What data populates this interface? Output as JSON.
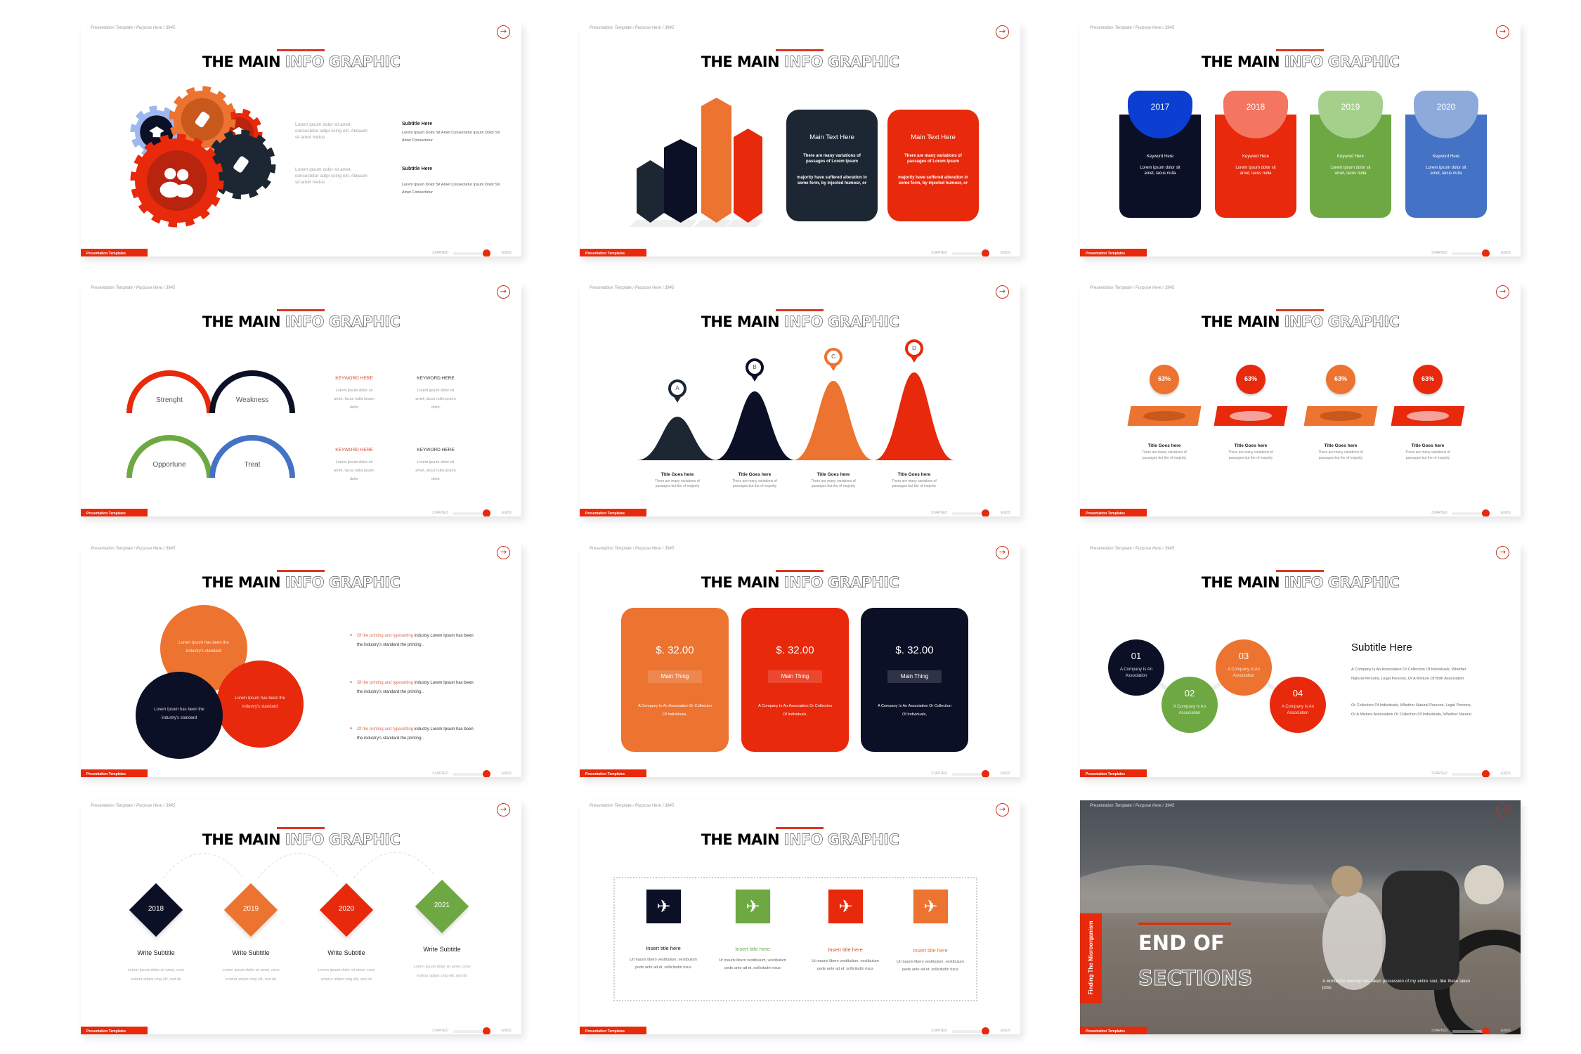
{
  "common": {
    "breadcrumb": "Presentation Template / Purpose Here / 3945",
    "title_bold": "THE MAIN",
    "title_outline": "INFO GRAPHIC",
    "footer_tag": "Presentation Templates",
    "started": "STARTED",
    "ends": "ENDS",
    "next_icon": "arrow-right-circle-icon",
    "next_glyph": "→"
  },
  "colors": {
    "accent_red": "#e8290b",
    "orange": "#ec7330",
    "navy": "#0b1026",
    "slate": "#1d2733",
    "green": "#6ea843",
    "blue": "#4472c4"
  },
  "slides": [
    {
      "type": "gears",
      "gears": [
        {
          "color": "#9db8ef",
          "inner": "#0b1026",
          "icon": "graduation-cap-icon"
        },
        {
          "color": "#e8290b",
          "inner": "#b8240d",
          "icon": "graduation-cap-icon"
        },
        {
          "color": "#ec7330",
          "inner": "#c9581c",
          "icon": "tag-icon"
        },
        {
          "color": "#1d2733",
          "inner": "#1d2733",
          "icon": "tag-icon"
        },
        {
          "color": "#e8290b",
          "inner": "#b8240d",
          "icon": "users-icon"
        }
      ],
      "blocks": [
        {
          "lorem": "Lorem ipsum dolor sit amet, consectetur adipi scing elit. Aliquam sit amet metus",
          "subtitle": "Subtitle Here",
          "body": "Lorem Ipsum Dolor Sit Amet Consectetur Ipsum Dolor Sit Amet Consectetur"
        },
        {
          "lorem": "Lorem ipsum dolor sit amet, consectetur adipi scing elit. Aliquam sit amet metus",
          "subtitle": "Subtitle Here",
          "body": "Lorem Ipsum Dolor Sit Amet Consectetur Ipsum Dolor Sit Amet Consectetur"
        }
      ]
    },
    {
      "type": "bars",
      "bar_colors": [
        "#1d2733",
        "#0b1026",
        "#ec7330",
        "#e8290b"
      ],
      "cards": [
        {
          "title": "Main Text Here",
          "p1": "There are many variations of passages of Lorem Ipsum",
          "p2": "majority have suffered alteration in some form, by injected humour, or",
          "color": "#1d2733"
        },
        {
          "title": "Main Text Here",
          "p1": "There are many variations of passages of Lorem Ipsum",
          "p2": "majority have suffered alteration in some form, by injected humour, or",
          "color": "#e8290b"
        }
      ]
    },
    {
      "type": "year-cards",
      "cards": [
        {
          "year": "2017",
          "keyword": "Keyword Here",
          "body": "Lorem ipsum dolor sit amet, lacus nulla",
          "color": "#0b1026",
          "tab": "#0a3fd1"
        },
        {
          "year": "2018",
          "keyword": "Keyword Here",
          "body": "Lorem ipsum dolor sit amet, lacus nulla",
          "color": "#e8290b",
          "tab": "#f47560"
        },
        {
          "year": "2019",
          "keyword": "Keyword Here",
          "body": "Lorem ipsum dolor sit amet, lacus nulla",
          "color": "#6ea843",
          "tab": "#a5d08c"
        },
        {
          "year": "2020",
          "keyword": "Keyword Here",
          "body": "Lorem ipsum dolor sit amet, lacus nulla",
          "color": "#4472c4",
          "tab": "#8eaadb"
        }
      ]
    },
    {
      "type": "swot-arcs",
      "arcs": [
        {
          "label": "Strenght",
          "color": "#e8290b"
        },
        {
          "label": "Weakness",
          "color": "#0b1026"
        },
        {
          "label": "Opportune",
          "color": "#6ea843"
        },
        {
          "label": "Treat",
          "color": "#4472c4"
        }
      ],
      "keywords": [
        {
          "title": "KEYWORD HERE",
          "body": "Lorem ipsum dolor sit amet, lacus nulla ipsum dolor",
          "color": "#d9432c"
        },
        {
          "title": "KEYWORD HERE",
          "body": "Lorem ipsum dolor sit amet, lacus nulla ipsum dolor",
          "color": "#333333"
        },
        {
          "title": "KEYWORD HERE",
          "body": "Lorem ipsum dolor sit amet, lacus nulla ipsum dolor",
          "color": "#d9432c"
        },
        {
          "title": "KEYWORD HERE",
          "body": "Lorem ipsum dolor sit amet, lacus nulla ipsum dolor",
          "color": "#333333"
        }
      ]
    },
    {
      "type": "peaks",
      "peaks": [
        {
          "letter": "A",
          "color": "#1d2733",
          "title": "Title Goes here",
          "body": "There are many variations of passages but the of majority"
        },
        {
          "letter": "B",
          "color": "#0b1026",
          "title": "Title Goes here",
          "body": "There are many variations of passages but the of majority"
        },
        {
          "letter": "C",
          "color": "#ec7330",
          "title": "Title Goes here",
          "body": "There are many variations of passages but the of majority"
        },
        {
          "letter": "D",
          "color": "#e8290b",
          "title": "Title Goes here",
          "body": "There are many variations of passages but the of majority"
        }
      ]
    },
    {
      "type": "percent-plates",
      "items": [
        {
          "value": "63%",
          "title": "Title Goes here",
          "body": "There are many variations of passages but the of majority",
          "color": "#ec7330",
          "ellipse": "#c9581c"
        },
        {
          "value": "63%",
          "title": "Title Goes here",
          "body": "There are many variations of passages but the of majority",
          "color": "#e8290b",
          "ellipse": "#f5a39a"
        },
        {
          "value": "63%",
          "title": "Title Goes here",
          "body": "There are many variations of passages but the of majority",
          "color": "#ec7330",
          "ellipse": "#c9581c"
        },
        {
          "value": "63%",
          "title": "Title Goes here",
          "body": "There are many variations of passages but the of majority",
          "color": "#e8290b",
          "ellipse": "#f5a39a"
        }
      ]
    },
    {
      "type": "venn",
      "circles": [
        {
          "text": "Lorem Ipsum has been the industry's standard",
          "color": "#ec7330"
        },
        {
          "text": "Lorem Ipsum has been the industry's standard",
          "color": "#e8290b"
        },
        {
          "text": "Lorem Ipsum has been the industry's standard",
          "color": "#0b1026"
        }
      ],
      "bullets": [
        {
          "highlight": "Of the printing and typesetting",
          "text": " industry Lorem Ipsum has been the industry's standard the printing ."
        },
        {
          "highlight": "Of the printing and typesetting",
          "text": " industry Lorem Ipsum has been the industry's standard the printing ."
        },
        {
          "highlight": "Of the printing and typesetting",
          "text": " industry Lorem Ipsum has been the industry's standard the printing ."
        }
      ]
    },
    {
      "type": "pricing",
      "cards": [
        {
          "price": "$. 32.00",
          "label": "Main Thing",
          "body": "A Company Is An Association Or Collection Of Individuals,",
          "color": "#ec7330"
        },
        {
          "price": "$. 32.00",
          "label": "Main Thing",
          "body": "A Company Is An Association Or Collection Of Individuals,",
          "color": "#e8290b"
        },
        {
          "price": "$. 32.00",
          "label": "Main Thing",
          "body": "A Company Is An Association Or Collection Of Individuals,",
          "color": "#0b1026"
        }
      ]
    },
    {
      "type": "numbered-circles",
      "circles": [
        {
          "num": "01",
          "text": "A Company Is An Association",
          "color": "#0b1026"
        },
        {
          "num": "02",
          "text": "A Company Is An Association",
          "color": "#6ea843"
        },
        {
          "num": "03",
          "text": "A Company Is An Association",
          "color": "#ec7330"
        },
        {
          "num": "04",
          "text": "A Company Is An Association",
          "color": "#e8290b"
        }
      ],
      "subtitle": "Subtitle Here",
      "p1": "A Company Is An Association Or Collection Of Individuals, Whether Natural Persons, Legal Persons, Or A Mixture Of Both Association",
      "p2": "Or Collection Of Individuals, Whether Natural Persons, Legal Persons, Or A Mixture Association Or Collection Of Individuals, Whether Natural"
    },
    {
      "type": "diamond-timeline",
      "diamonds": [
        {
          "year": "2018",
          "title": "Write Subtitle",
          "body": "Lorem ipsum dolor sit amet, cons ectetur adipis cing elit, sed do",
          "color": "#0b1026"
        },
        {
          "year": "2019",
          "title": "Write Subtitle",
          "body": "Lorem ipsum dolor sit amet, cons ectetur adipis cing elit, sed do",
          "color": "#ec7330"
        },
        {
          "year": "2020",
          "title": "Write Subtitle",
          "body": "Lorem ipsum dolor sit amet, cons ectetur adipis cing elit, sed do",
          "color": "#e8290b"
        },
        {
          "year": "2021",
          "title": "Write Subtitle",
          "body": "Lorem ipsum dolor sit amet, cons ectetur adipis cing elit, sed do",
          "color": "#6ea843"
        }
      ]
    },
    {
      "type": "plane-icons",
      "icon": "airplane-icon",
      "glyph": "✈",
      "items": [
        {
          "title": "Insert title here",
          "body": "Ut mauris libero vestibulum, vestibulum pede ante ad et, sollicitudin risus",
          "color": "#0b1026",
          "title_color": "#111111"
        },
        {
          "title": "Insert title here",
          "body": "Ut mauris libero vestibulum, vestibulum pede ante ad et, sollicitudin risus",
          "color": "#6ea843",
          "title_color": "#6ea843"
        },
        {
          "title": "Insert title here",
          "body": "Ut mauris libero vestibulum, vestibulum pede ante ad et, sollicitudin risus",
          "color": "#e8290b",
          "title_color": "#d9432c"
        },
        {
          "title": "Insert title here",
          "body": "Ut mauris libero vestibulum, vestibulum pede ante ad et, sollicitudin risus",
          "color": "#ec7330",
          "title_color": "#ec7330"
        }
      ]
    },
    {
      "type": "end-section",
      "side_label": "Finding The Microorganism",
      "heading_solid": "END OF",
      "heading_outline": "SECTIONS",
      "body": "A wonderful serenity has taken possession of my entire soul, like these taken poss"
    }
  ]
}
